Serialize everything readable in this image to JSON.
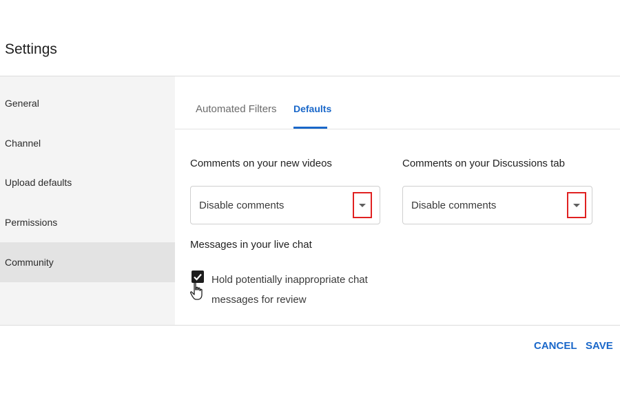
{
  "header": {
    "title": "Settings"
  },
  "sidebar": {
    "items": [
      {
        "label": "General"
      },
      {
        "label": "Channel"
      },
      {
        "label": "Upload defaults"
      },
      {
        "label": "Permissions"
      },
      {
        "label": "Community",
        "active": true
      }
    ]
  },
  "tabs": [
    {
      "label": "Automated Filters",
      "active": false
    },
    {
      "label": "Defaults",
      "active": true
    }
  ],
  "comments_new_videos": {
    "label": "Comments on your new videos",
    "value": "Disable comments"
  },
  "comments_discussions": {
    "label": "Comments on your Discussions tab",
    "value": "Disable comments"
  },
  "live_chat": {
    "heading": "Messages in your live chat",
    "checkbox_label": "Hold potentially inappropriate chat messages for review",
    "checked": true
  },
  "footer": {
    "cancel_label": "CANCEL",
    "save_label": "SAVE"
  },
  "colors": {
    "accent": "#1967c9",
    "highlight": "#e02020",
    "sidebar_bg": "#f4f4f4",
    "sidebar_active_bg": "#e3e3e3"
  }
}
